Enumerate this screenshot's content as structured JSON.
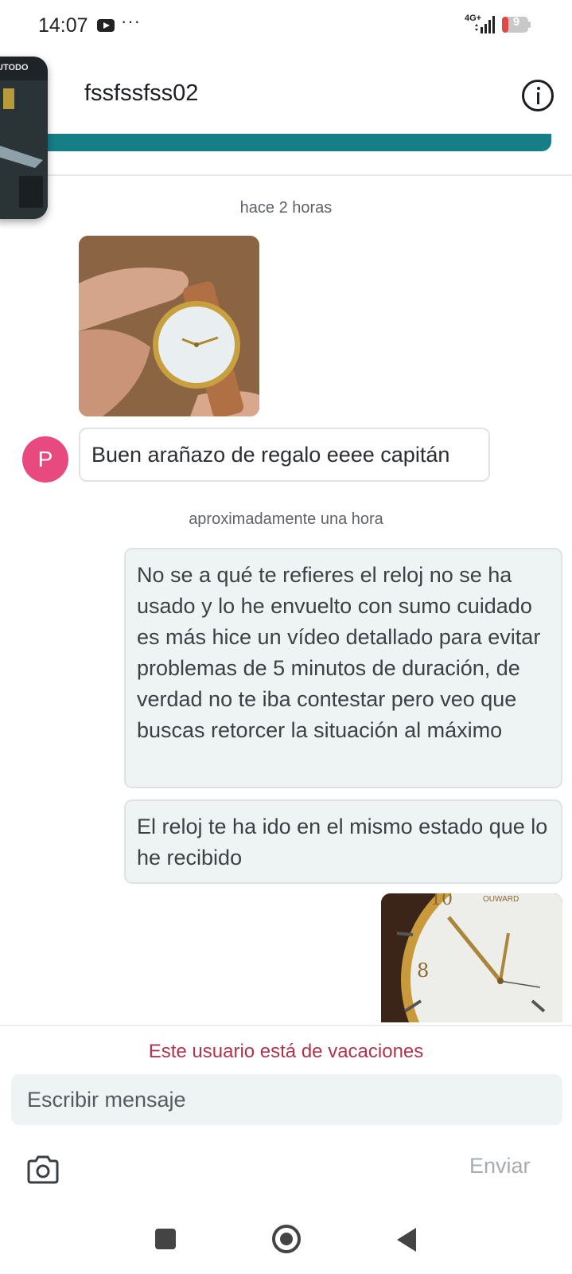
{
  "status_bar": {
    "time": "14:07",
    "more": "···",
    "network": "4G+",
    "battery": "9",
    "icons": [
      "youtube-icon",
      "signal-icon",
      "battery-icon"
    ]
  },
  "header": {
    "title": "fssfssfss02",
    "info_icon": "info-icon"
  },
  "pip": {
    "label": "UTODO"
  },
  "messages": {
    "timestamp_1": "hace 2 horas",
    "incoming": {
      "avatar_initial": "P",
      "text": "Buen arañazo de regalo eeee capitán"
    },
    "timestamp_2": "aproximadamente una hora",
    "outgoing_1": "No se a qué te refieres el reloj no se ha usado y lo he envuelto con sumo cuidado es más hice un vídeo detallado para evitar problemas de 5 minutos de duración, de verdad no te iba contestar pero veo que buscas retorcer la situación al máximo",
    "outgoing_2": "El reloj te ha ido en el mismo estado que lo he recibido",
    "watch_brand": "OUWARD"
  },
  "composer": {
    "vacation_notice": "Este usuario está de vacaciones",
    "placeholder": "Escribir mensaje",
    "send_label": "Enviar",
    "camera_icon": "camera-icon"
  },
  "colors": {
    "accent_teal": "#167f86",
    "avatar_pink": "#e84a7f",
    "notice_red": "#b1344d",
    "bubble_out": "#eef3f3"
  }
}
